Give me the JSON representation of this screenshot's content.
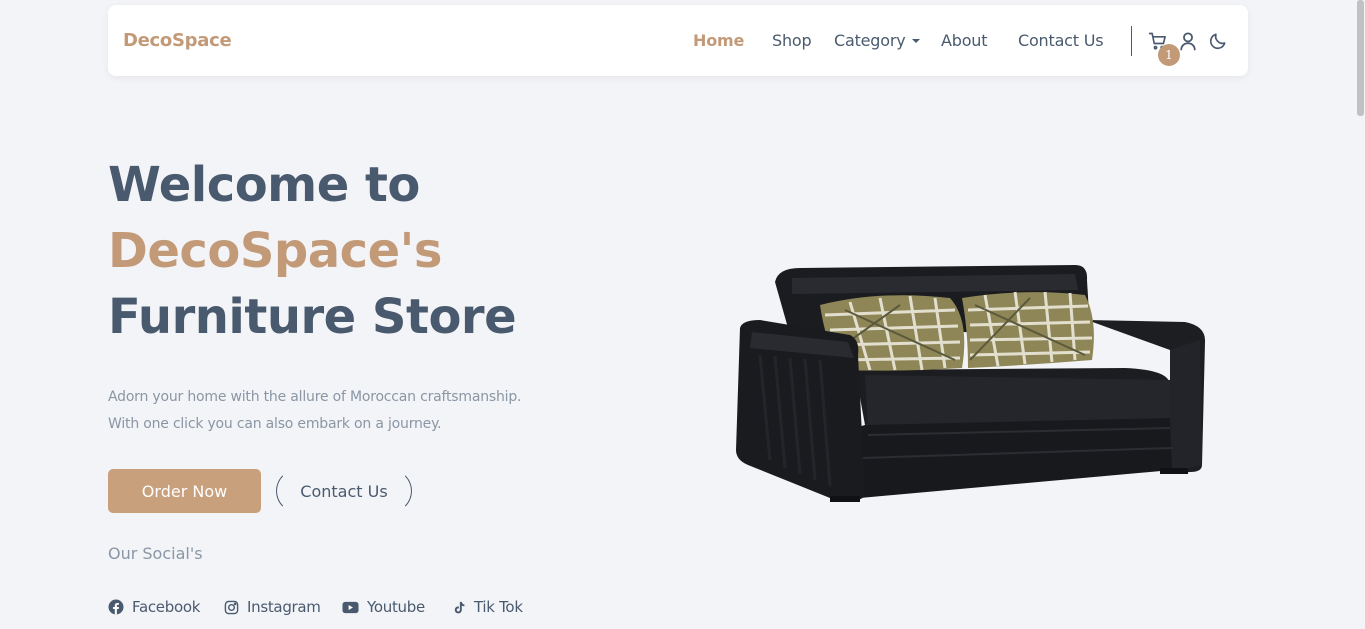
{
  "brand": "DecoSpace",
  "nav": {
    "home": "Home",
    "shop": "Shop",
    "category": "Category",
    "about": "About",
    "contact": "Contact Us"
  },
  "cart": {
    "count": "1",
    "icon": "cart-icon"
  },
  "icons": [
    "cart-icon",
    "user-icon",
    "moon-icon"
  ],
  "hero": {
    "line1": "Welcome to",
    "line2": "DecoSpace's",
    "line3": "Furniture Store",
    "desc1": "Adorn your home with the allure of Moroccan craftsmanship.",
    "desc2": "With one click you can also embark on a journey.",
    "order_btn": "Order Now",
    "contact_btn": "Contact Us"
  },
  "socials": {
    "title": "Our Social's",
    "items": [
      "Facebook",
      "Instagram",
      "Youtube",
      "Tik Tok"
    ]
  },
  "colors": {
    "accent": "#c39a77",
    "text": "#4a5a6e",
    "muted": "#8a96a4",
    "background": "#f3f4f8"
  }
}
